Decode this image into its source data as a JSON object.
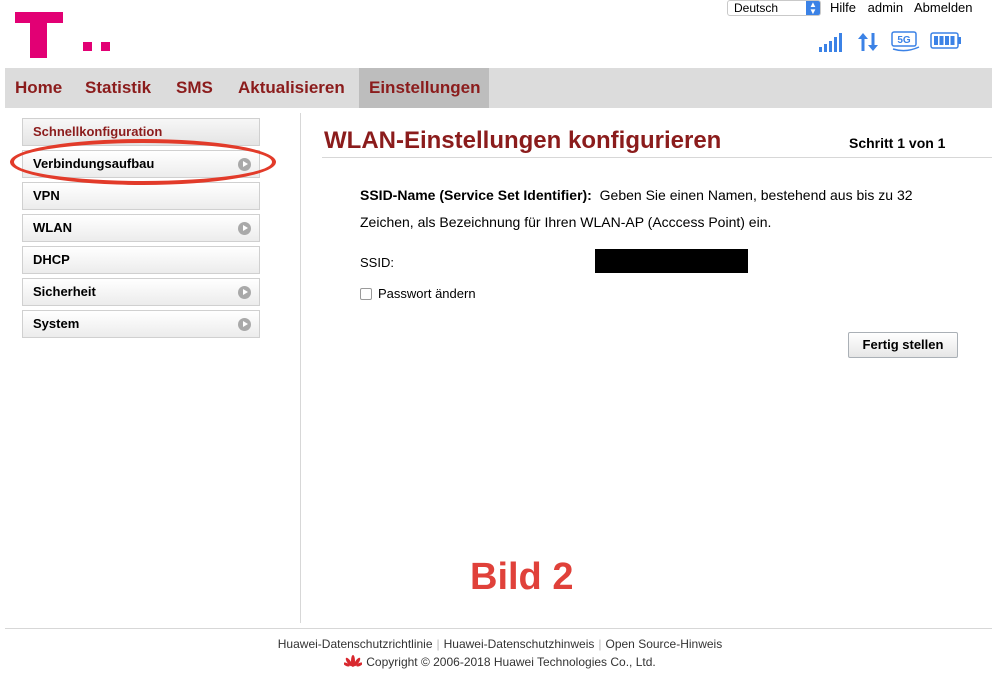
{
  "header": {
    "language": "Deutsch",
    "links": {
      "help": "Hilfe",
      "user": "admin",
      "logout": "Abmelden"
    }
  },
  "nav": {
    "items": [
      "Home",
      "Statistik",
      "SMS",
      "Aktualisieren",
      "Einstellungen"
    ],
    "active": "Einstellungen"
  },
  "sidebar": {
    "items": [
      {
        "label": "Schnellkonfiguration"
      },
      {
        "label": "Verbindungsaufbau"
      },
      {
        "label": "VPN"
      },
      {
        "label": "WLAN"
      },
      {
        "label": "DHCP"
      },
      {
        "label": "Sicherheit"
      },
      {
        "label": "System"
      }
    ]
  },
  "main": {
    "title": "WLAN-Einstellungen konfigurieren",
    "step": "Schritt 1 von 1",
    "ssid_name_label": "SSID-Name (Service Set Identifier):",
    "description": "Geben Sie einen Namen, bestehend aus bis zu 32 Zeichen, als Bezeichnung für Ihren WLAN-AP (Acccess Point) ein.",
    "ssid_label": "SSID:",
    "ssid_value": "",
    "password_change_label": "Passwort ändern",
    "password_change_checked": false,
    "finish_button": "Fertig stellen"
  },
  "annotation": "Bild 2",
  "footer": {
    "links": [
      "Huawei-Datenschutzrichtlinie",
      "Huawei-Datenschutzhinweis",
      "Open Source-Hinweis"
    ],
    "copyright": "Copyright © 2006-2018 Huawei Technologies Co., Ltd."
  },
  "colors": {
    "brand_magenta": "#e20074",
    "nav_text": "#8b1c1c",
    "annotation_red": "#e0413a",
    "status_icon_blue": "#3b82e6"
  },
  "icons": {
    "status": [
      "signal-strength-icon",
      "data-transfer-icon",
      "5g-network-icon",
      "battery-icon"
    ]
  }
}
